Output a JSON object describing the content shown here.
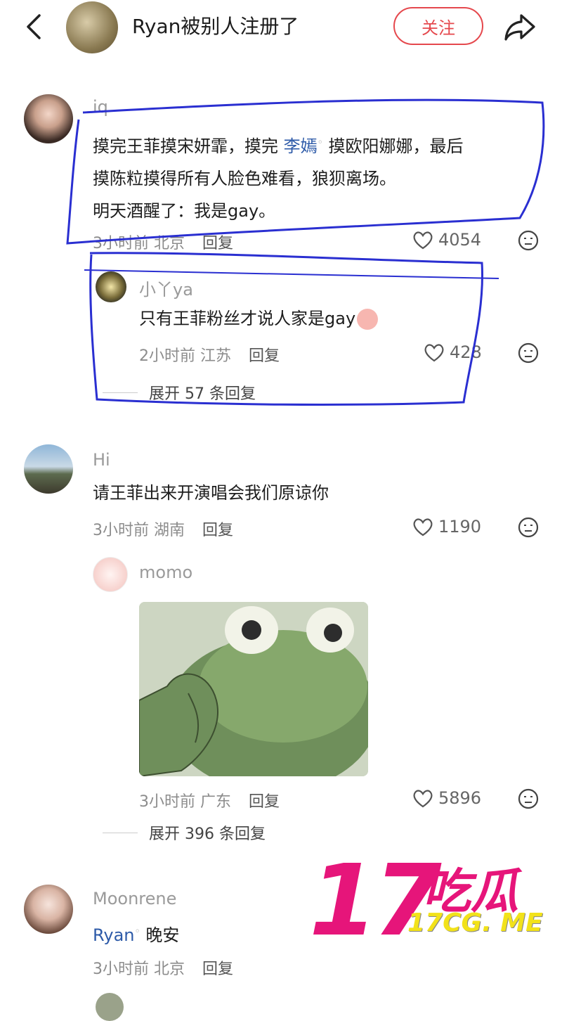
{
  "header": {
    "title": "Ryan被别人注册了",
    "follow_label": "关注"
  },
  "comments": [
    {
      "user": "iq",
      "lines": [
        "摸完王菲摸宋妍霏，摸完",
        "摸欧阳娜娜，最后",
        "摸陈粒摸得所有人脸色难看，狼狈离场。",
        "明天酒醒了：我是gay。"
      ],
      "mention": "李嫣",
      "time": "3小时前",
      "location": "北京",
      "reply": "回复",
      "likes": "4054"
    },
    {
      "user": "小丫ya",
      "text": "只有王菲粉丝才说人家是gay",
      "time": "2小时前",
      "location": "江苏",
      "reply": "回复",
      "likes": "428",
      "expand": "展开 57 条回复"
    },
    {
      "user": "Hi",
      "text": "请王菲出来开演唱会我们原谅你",
      "time": "3小时前",
      "location": "湖南",
      "reply": "回复",
      "likes": "1190"
    },
    {
      "user": "momo",
      "time": "3小时前",
      "location": "广东",
      "reply": "回复",
      "likes": "5896",
      "expand": "展开 396 条回复"
    },
    {
      "user": "Moonrene",
      "mention": "Ryan",
      "text": "晚安",
      "time": "3小时前",
      "location": "北京",
      "reply": "回复"
    }
  ],
  "watermark": {
    "number": "17",
    "name": "吃瓜",
    "url": "17CG. ME"
  },
  "colors": {
    "accent": "#e5484d",
    "mention": "#2d5aa8",
    "annotation": "#2a2fd1",
    "watermark": "#e6157a"
  }
}
